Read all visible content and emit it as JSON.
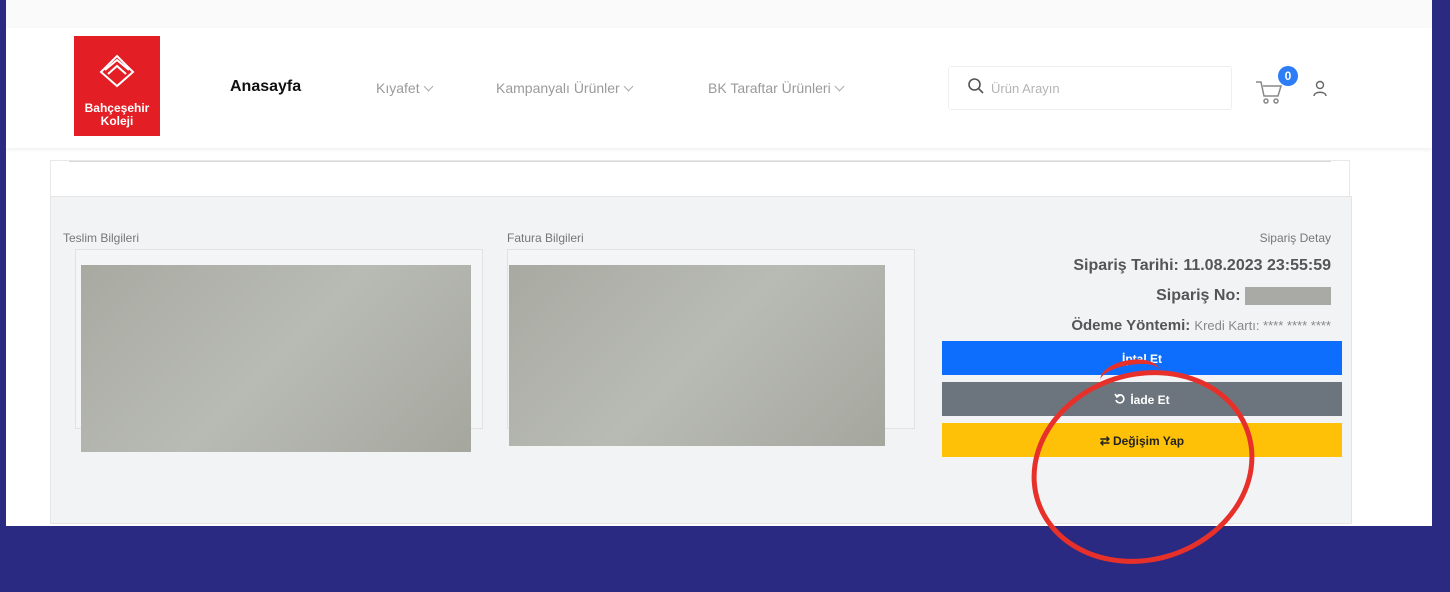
{
  "header": {
    "logo_line1": "Bahçeşehir",
    "logo_line2": "Koleji",
    "nav": [
      "Anasayfa",
      "Kıyafet",
      "Kampanyalı Ürünler",
      "BK Taraftar Ürünleri"
    ],
    "search_placeholder": "Ürün Arayın",
    "cart_count": "0"
  },
  "order": {
    "delivery_label": "Teslim Bilgileri",
    "billing_label": "Fatura Bilgileri",
    "detail_label": "Sipariş Detay",
    "date_label": "Sipariş Tarihi:",
    "date_value": "11.08.2023 23:55:59",
    "no_label": "Sipariş No:",
    "payment_label": "Ödeme Yöntemi:",
    "payment_value": "Kredi Kartı: **** **** ****"
  },
  "actions": {
    "cancel": "İptal Et",
    "return": "İade Et",
    "exchange": "Değişim Yap"
  },
  "colors": {
    "brand_red": "#e31e24",
    "cancel_blue": "#0d6efd",
    "return_gray": "#6c757d",
    "exchange_yellow": "#ffc107",
    "annotation_red": "#e8302a",
    "frame": "#2a2a82"
  }
}
